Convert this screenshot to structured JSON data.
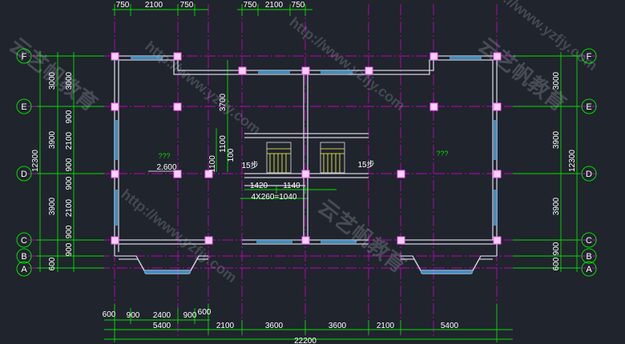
{
  "axes": {
    "left": [
      {
        "label": "F"
      },
      {
        "label": "E"
      },
      {
        "label": "D"
      },
      {
        "label": "C"
      },
      {
        "label": "B"
      },
      {
        "label": "A"
      }
    ],
    "right": [
      {
        "label": "F"
      },
      {
        "label": "E"
      },
      {
        "label": "D"
      },
      {
        "label": "C"
      },
      {
        "label": "B"
      },
      {
        "label": "A"
      }
    ]
  },
  "dims": {
    "top_left": [
      "750",
      "2100",
      "750"
    ],
    "top_mid": [
      "750",
      "2100",
      "750"
    ],
    "left_outer_total": "12300",
    "left_outer": [
      "3000",
      "3900",
      "3900",
      "600"
    ],
    "left_inner": [
      "3000",
      "900",
      "2100",
      "900",
      "900",
      "2100",
      "900",
      "900"
    ],
    "right_outer_total": "12300",
    "right_outer": [
      "3000",
      "3900",
      "3900",
      "900",
      "600"
    ],
    "mid_vert": [
      "3700",
      "1100",
      "1100",
      "100"
    ],
    "bottom_row1": [
      "600",
      "900",
      "2400",
      "900",
      "600"
    ],
    "bottom_row2": [
      "5400",
      "2100",
      "3600",
      "3600",
      "2100",
      "5400"
    ],
    "bottom_total": "22200"
  },
  "annotations": {
    "room_left": "???",
    "room_right": "???",
    "elevation": "2.600",
    "stair_left": "15步",
    "stair_right": "15步",
    "stair_w1": "1420",
    "stair_w2": "1140",
    "stair_run": "4X260=1040"
  },
  "watermark": {
    "url": "http://www.yzfjy.com",
    "brand": "云艺帆教育"
  },
  "colors": {
    "background": "#20242c",
    "axis_green": "#00e000",
    "wall": "#c8c8d8",
    "column": "#ff80ff",
    "window": "#5aa8d8",
    "grid_magenta": "#d000d0"
  }
}
